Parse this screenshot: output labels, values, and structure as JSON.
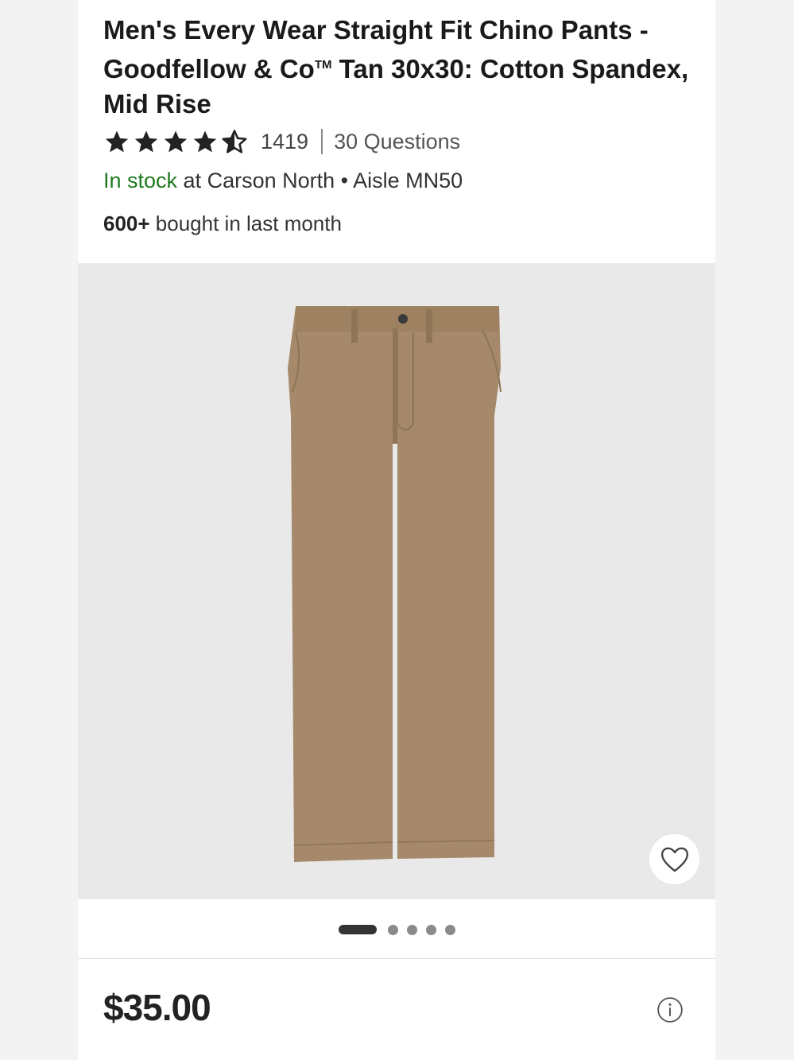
{
  "product": {
    "title_main": "Men's Every Wear Straight Fit Chino Pants - Goodfellow & Co",
    "title_tm": "TM",
    "title_rest": " Tan 30x30: Cotton Spandex, Mid Rise",
    "rating": 4.5,
    "rating_max": 5,
    "review_count": "1419",
    "questions_link": "30 Questions",
    "stock_status": "In stock",
    "stock_location": " at Carson North • Aisle MN50",
    "bought_count": "600+",
    "bought_text": " bought in last month",
    "price": "$35.00",
    "image_color": "#a5896a"
  },
  "gallery": {
    "total_images": 5,
    "active_index": 0
  },
  "icons": {
    "favorite": "heart-outline-icon",
    "info": "info-circle-icon",
    "star": "star-icon"
  },
  "colors": {
    "in_stock": "#1f7a1f",
    "image_background": "#e9e9e9"
  }
}
